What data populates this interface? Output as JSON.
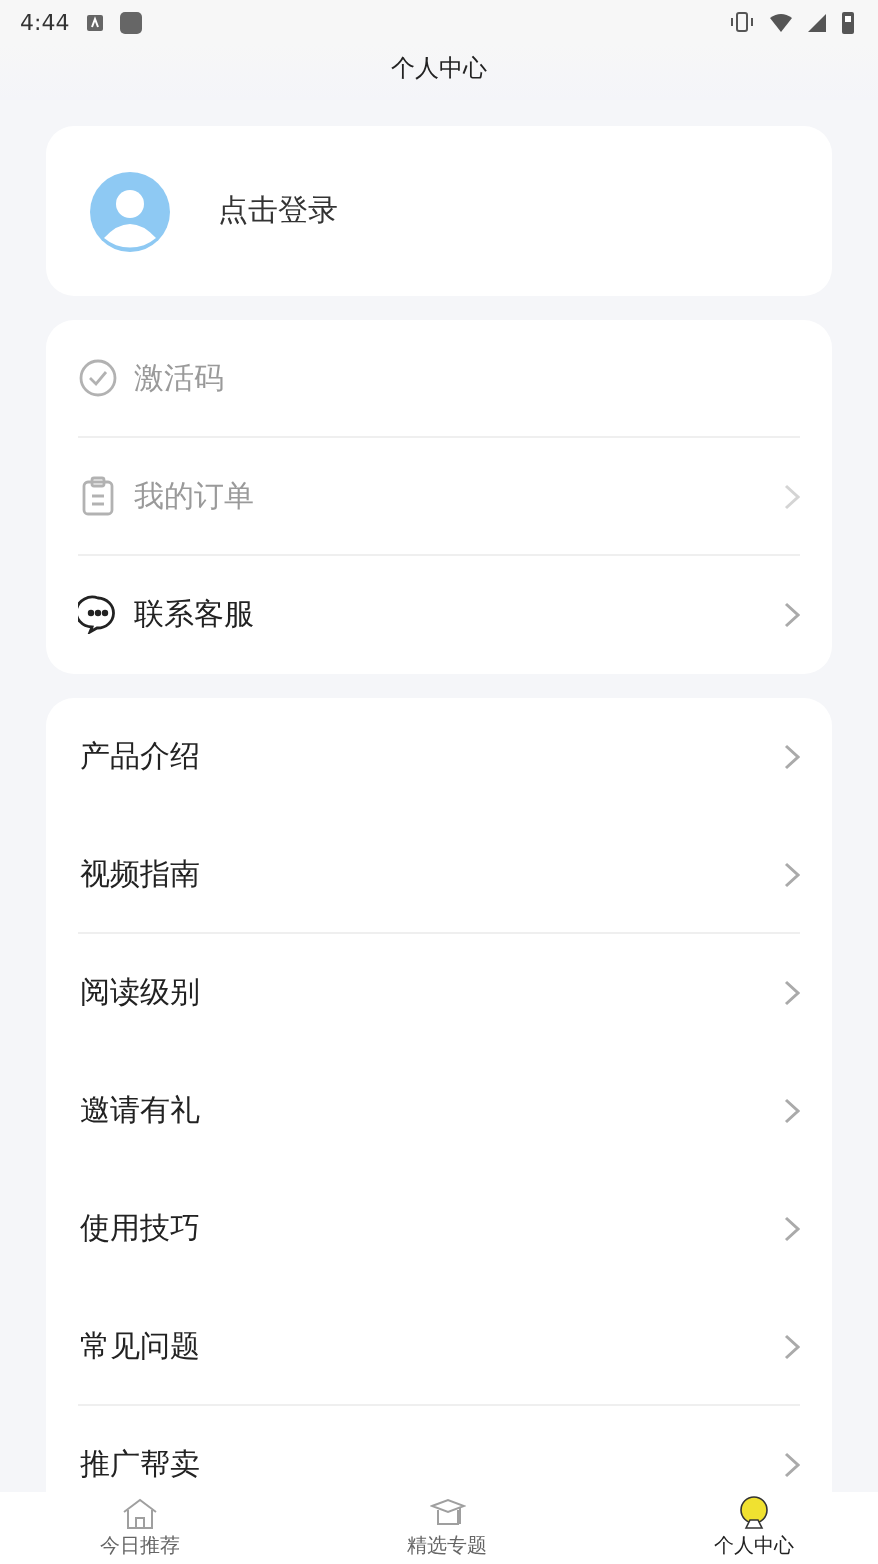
{
  "status_bar": {
    "time": "4:44"
  },
  "title": "个人中心",
  "login": {
    "label": "点击登录"
  },
  "account_menu": [
    {
      "label": "激活码",
      "kind": "check",
      "disabled": true,
      "arrow": false,
      "divider": true
    },
    {
      "label": "我的订单",
      "kind": "clipboard",
      "disabled": true,
      "arrow": true,
      "divider": true
    },
    {
      "label": "联系客服",
      "kind": "chat",
      "disabled": false,
      "arrow": true,
      "divider": false
    }
  ],
  "info_menu": [
    {
      "label": "产品介绍",
      "divider": false
    },
    {
      "label": "视频指南",
      "divider": true
    },
    {
      "label": "阅读级别",
      "divider": false
    },
    {
      "label": "邀请有礼",
      "divider": false
    },
    {
      "label": "使用技巧",
      "divider": false
    },
    {
      "label": "常见问题",
      "divider": true
    },
    {
      "label": "推广帮卖"
    }
  ],
  "tabs": [
    {
      "label": "今日推荐",
      "kind": "home",
      "selected": false
    },
    {
      "label": "精选专题",
      "kind": "cap",
      "selected": false
    },
    {
      "label": "个人中心",
      "kind": "bulb",
      "selected": true
    }
  ]
}
